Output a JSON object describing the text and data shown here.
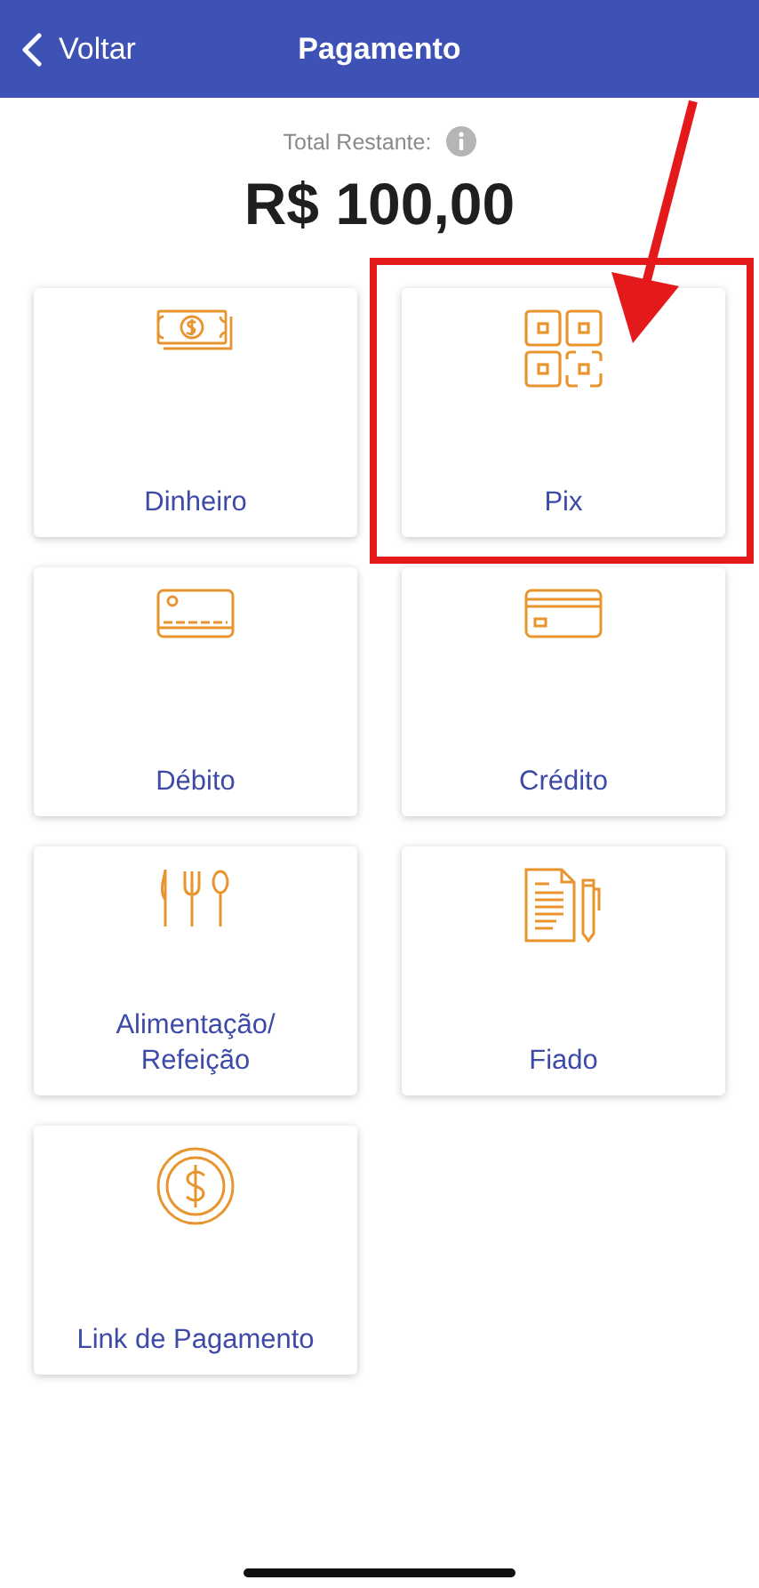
{
  "header": {
    "back_label": "Voltar",
    "title": "Pagamento"
  },
  "total": {
    "label": "Total Restante:",
    "amount": "R$ 100,00"
  },
  "options": [
    {
      "label": "Dinheiro",
      "highlighted": false
    },
    {
      "label": "Pix",
      "highlighted": true
    },
    {
      "label": "Débito",
      "highlighted": false
    },
    {
      "label": "Crédito",
      "highlighted": false
    },
    {
      "label": "Alimentação/ Refeição",
      "highlighted": false
    },
    {
      "label": "Fiado",
      "highlighted": false
    },
    {
      "label": "Link de Pagamento",
      "highlighted": false
    }
  ]
}
